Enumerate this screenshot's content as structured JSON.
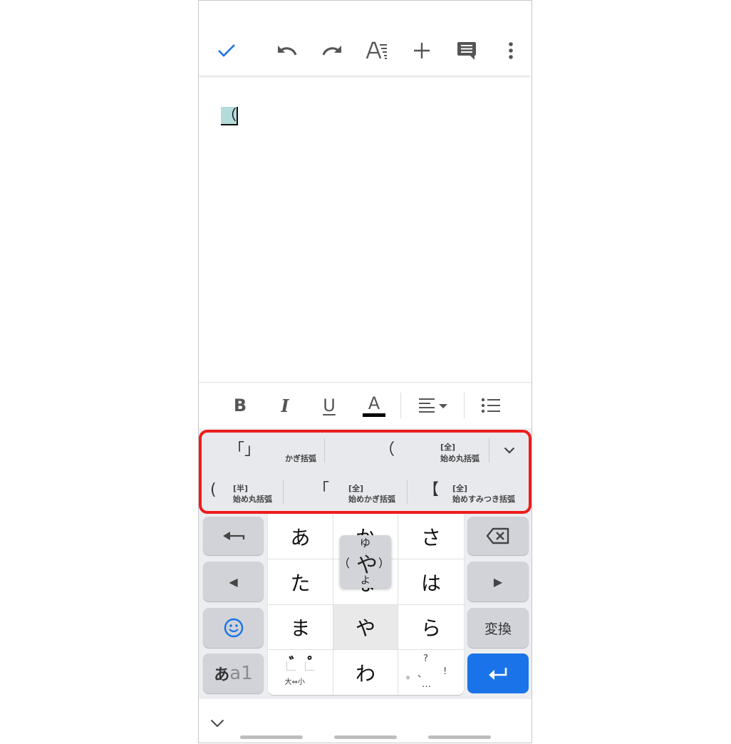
{
  "toolbar": {
    "icons": [
      "checkmark-icon",
      "undo-icon",
      "redo-icon",
      "text-format-icon",
      "insert-plus-icon",
      "comment-icon",
      "more-vert-icon"
    ],
    "accent_color": "#1a73e8"
  },
  "document": {
    "composing_text": "（",
    "highlight_color": "#b3dcdb"
  },
  "format_bar": {
    "bold": "B",
    "italic": "I",
    "underline": "U",
    "text_color": "A"
  },
  "candidates": {
    "row1": [
      {
        "symbol": "「」",
        "label_tag": "",
        "label": "かぎ括弧"
      },
      {
        "symbol": "（",
        "label_tag": "[全]",
        "label": "始め丸括弧"
      }
    ],
    "row2": [
      {
        "symbol": "(",
        "label_tag": "[半]",
        "label": "始め丸括弧"
      },
      {
        "symbol": "「",
        "label_tag": "[全]",
        "label": "始めかぎ括弧"
      },
      {
        "symbol": "【",
        "label_tag": "[全]",
        "label": "始めすみつき括弧"
      }
    ],
    "highlight_color": "#ee1c1c"
  },
  "keyboard": {
    "left_keys": {
      "undo": "⟵",
      "left": "◀",
      "emoji": "☺",
      "mode": {
        "kana": "あ",
        "latin": "a1"
      }
    },
    "kana": [
      [
        "あ",
        "か",
        "さ"
      ],
      [
        "た",
        "な",
        "は"
      ],
      [
        "ま",
        "や",
        "ら"
      ],
      [
        "゛゜",
        "わ",
        "、。?!"
      ]
    ],
    "dakuten_key": {
      "top_left": "゛",
      "top_right": "゜",
      "bottom": "大⇔小"
    },
    "punct_key": {
      "top": "?",
      "left": "。",
      "mid": "、",
      "right": "!",
      "bottom": "…"
    },
    "right_keys": {
      "backspace": "⌫",
      "right": "▶",
      "convert": "変換",
      "enter": "↵"
    },
    "flick_popup": {
      "center": "や",
      "top": "ゆ",
      "left": "（",
      "right": "）",
      "bottom": "よ"
    }
  },
  "navbar": {
    "collapse_icon": "chevron-down-icon"
  }
}
